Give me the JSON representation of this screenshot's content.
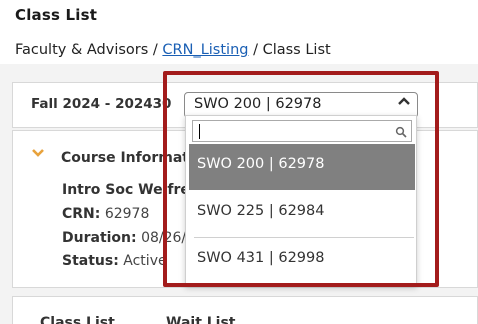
{
  "page_title": "Class List",
  "breadcrumb": {
    "part1": "Faculty & Advisors /",
    "link": "CRN_Listing",
    "part3": "/ Class List"
  },
  "term": {
    "label": "Fall 2024 - 202430",
    "selected_crn": "SWO 200 | 62978"
  },
  "dropdown": {
    "search_value": "",
    "options": [
      {
        "label": "SWO 200 | 62978",
        "selected": true
      },
      {
        "label": "SWO 225 | 62984",
        "selected": false
      },
      {
        "label": "SWO 431 | 62998",
        "selected": false
      }
    ]
  },
  "course_info": {
    "header": "Course Informat",
    "title": "Intro Soc Welfre",
    "crn_label": "CRN:",
    "crn_value": "62978",
    "duration_label": "Duration:",
    "duration_value": "08/26/",
    "status_label": "Status:",
    "status_value": "Active"
  },
  "tabs": [
    "Class List",
    "Wait List"
  ],
  "colors": {
    "highlight": "#a31c1c",
    "link": "#1a5fb4",
    "chevron": "#e8a23c",
    "selected_option_bg": "#808080"
  }
}
